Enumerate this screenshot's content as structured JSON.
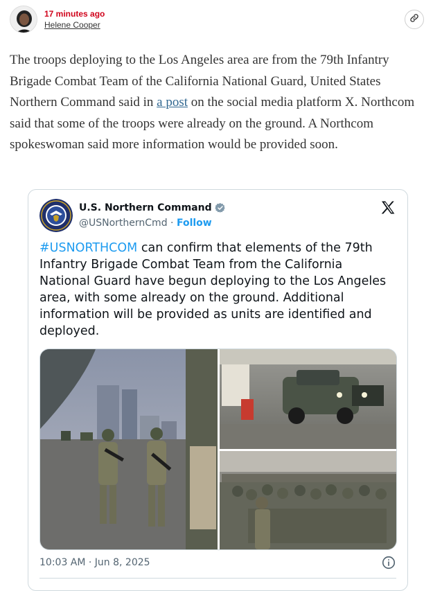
{
  "byline": {
    "time": "17 minutes ago",
    "author": "Helene Cooper"
  },
  "article": {
    "text_before_link": "The troops deploying to the Los Angeles area are from the 79th Infantry Brigade Combat Team of the California National Guard, United States Northern Command said in ",
    "link_text": "a post",
    "text_after_link": " on the social media platform X. Northcom said that some of the troops were already on the ground. A Northcom spokeswoman said more information would be provided soon."
  },
  "tweet": {
    "display_name": "U.S. Northern Command",
    "handle": "@USNorthernCmd",
    "separator": " · ",
    "follow_label": "Follow",
    "hashtag": "#USNORTHCOM",
    "body": " can confirm that elements of the 79th Infantry Brigade Combat Team from the California National Guard have begun deploying to the Los Angeles area, with some already on the ground. Additional information will be provided as units are identified and deployed.",
    "timestamp": "10:03 AM · Jun 8, 2025",
    "icons": {
      "share": "link-icon",
      "verified": "verified-badge-icon",
      "platform": "x-logo-icon",
      "info": "info-icon"
    }
  },
  "colors": {
    "timestamp_red": "#d0021b",
    "link_blue": "#326891",
    "x_blue": "#1d9bf0",
    "verified_gray": "#829aab",
    "text_dark": "#0f1419",
    "text_muted": "#536471"
  }
}
